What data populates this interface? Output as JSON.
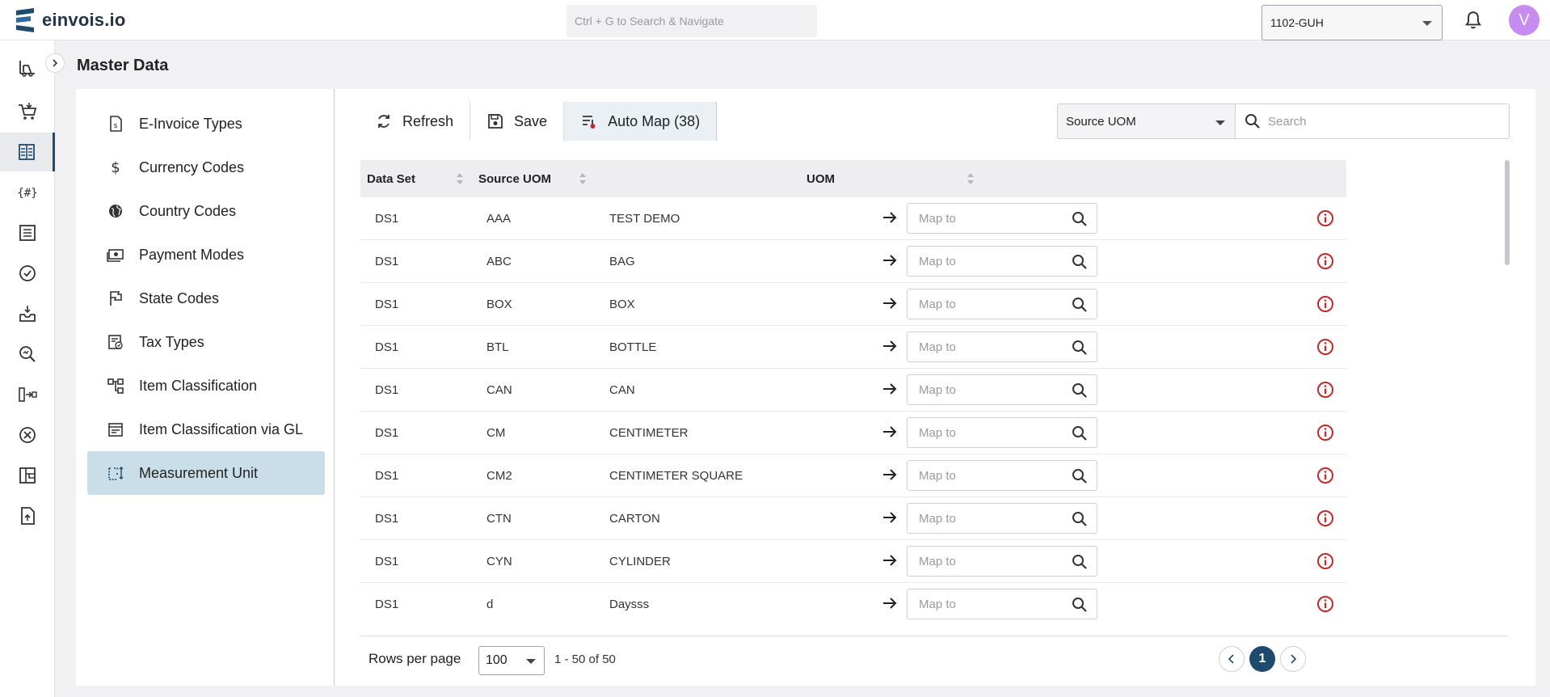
{
  "brand": {
    "name": "einvois.io"
  },
  "header": {
    "search_placeholder": "Ctrl + G to Search & Navigate",
    "company": "1102-GUH",
    "avatar_initial": "V"
  },
  "page_title": "Master Data",
  "rail": {
    "items": [
      "forklift-icon",
      "cart-icon",
      "ledger-icon",
      "hash-icon",
      "list-icon",
      "check-circle-icon",
      "inbox-icon",
      "zoom-icon",
      "transfer-icon",
      "cancel-icon",
      "dashboard-icon",
      "file-upload-icon"
    ],
    "active": "ledger-icon"
  },
  "menu": {
    "items": [
      {
        "label": "E-Invoice Types",
        "icon": "invoice-icon"
      },
      {
        "label": "Currency Codes",
        "icon": "dollar-icon"
      },
      {
        "label": "Country Codes",
        "icon": "globe-icon"
      },
      {
        "label": "Payment Modes",
        "icon": "money-icon"
      },
      {
        "label": "State Codes",
        "icon": "flag-icon"
      },
      {
        "label": "Tax Types",
        "icon": "tax-doc-icon"
      },
      {
        "label": "Item Classification",
        "icon": "hierarchy-icon"
      },
      {
        "label": "Item Classification via GL",
        "icon": "card-icon"
      },
      {
        "label": "Measurement Unit",
        "icon": "measure-icon"
      }
    ],
    "active": "Measurement Unit"
  },
  "toolbar": {
    "refresh_label": "Refresh",
    "save_label": "Save",
    "auto_map_label": "Auto Map (38)"
  },
  "filter": {
    "selected": "Source UOM",
    "search_placeholder": "Search"
  },
  "table": {
    "columns": [
      "Data Set",
      "Source UOM",
      "UOM"
    ],
    "map_placeholder": "Map to",
    "rows": [
      {
        "dataset": "DS1",
        "code": "AAA",
        "desc": "TEST DEMO"
      },
      {
        "dataset": "DS1",
        "code": "ABC",
        "desc": "BAG"
      },
      {
        "dataset": "DS1",
        "code": "BOX",
        "desc": "BOX"
      },
      {
        "dataset": "DS1",
        "code": "BTL",
        "desc": "BOTTLE"
      },
      {
        "dataset": "DS1",
        "code": "CAN",
        "desc": "CAN"
      },
      {
        "dataset": "DS1",
        "code": "CM",
        "desc": "CENTIMETER"
      },
      {
        "dataset": "DS1",
        "code": "CM2",
        "desc": "CENTIMETER SQUARE"
      },
      {
        "dataset": "DS1",
        "code": "CTN",
        "desc": "CARTON"
      },
      {
        "dataset": "DS1",
        "code": "CYN",
        "desc": "CYLINDER"
      },
      {
        "dataset": "DS1",
        "code": "d",
        "desc": "Daysss"
      }
    ]
  },
  "footer": {
    "rows_per_page_label": "Rows per page",
    "rows_per_page": "100",
    "range": "1 - 50 of 50",
    "current_page": "1"
  },
  "colors": {
    "accent": "#1e4a6e",
    "active_menu": "#c9dee8",
    "info_red": "#c62828",
    "avatar": "#c78cf0"
  }
}
